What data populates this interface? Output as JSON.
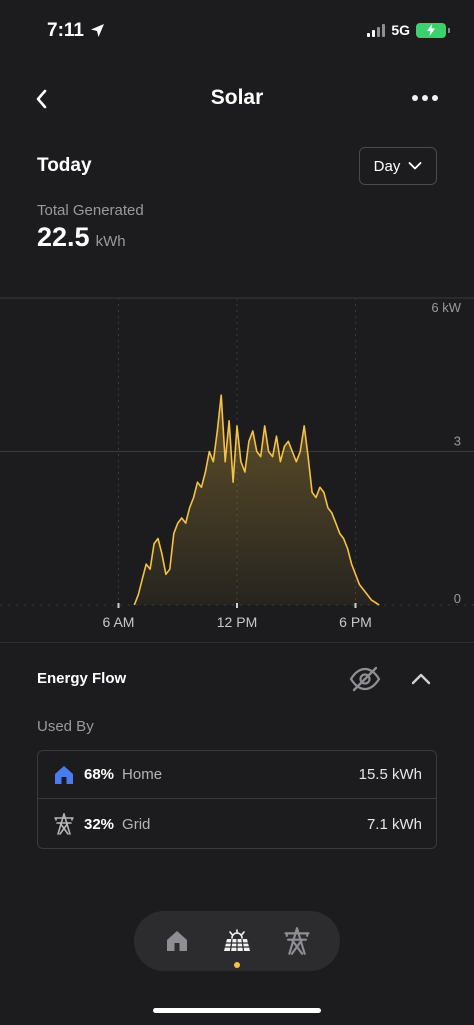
{
  "status_bar": {
    "time": "7:11",
    "network": "5G"
  },
  "header": {
    "title": "Solar"
  },
  "period": {
    "title": "Today",
    "selected": "Day"
  },
  "summary": {
    "label": "Total Generated",
    "value": "22.5",
    "unit": "kWh"
  },
  "chart_data": {
    "type": "area",
    "x_ticks": [
      "6 AM",
      "12 PM",
      "6 PM"
    ],
    "y_ticks": [
      "6 kW",
      "3",
      "0"
    ],
    "ylim": [
      0,
      6
    ],
    "xlim": [
      0,
      24
    ],
    "x": [
      6.8,
      7.0,
      7.2,
      7.4,
      7.6,
      7.8,
      8.0,
      8.2,
      8.4,
      8.6,
      8.8,
      9.0,
      9.2,
      9.4,
      9.6,
      9.8,
      10.0,
      10.2,
      10.4,
      10.6,
      10.8,
      11.0,
      11.2,
      11.4,
      11.6,
      11.8,
      12.0,
      12.2,
      12.4,
      12.6,
      12.8,
      13.0,
      13.2,
      13.4,
      13.6,
      13.8,
      14.0,
      14.2,
      14.4,
      14.6,
      14.8,
      15.0,
      15.2,
      15.4,
      15.6,
      15.8,
      16.0,
      16.2,
      16.4,
      16.6,
      16.8,
      17.0,
      17.2,
      17.4,
      17.6,
      17.8,
      18.0,
      18.2,
      18.4,
      18.6,
      18.8,
      19.0,
      19.2
    ],
    "values": [
      0.0,
      0.2,
      0.5,
      0.8,
      0.7,
      1.2,
      1.3,
      1.0,
      0.6,
      0.7,
      1.4,
      1.6,
      1.7,
      1.6,
      1.9,
      2.1,
      2.4,
      2.3,
      2.6,
      3.0,
      2.8,
      3.4,
      4.1,
      2.8,
      3.6,
      2.4,
      3.5,
      2.8,
      2.6,
      3.2,
      3.4,
      3.0,
      2.9,
      3.5,
      3.0,
      2.9,
      3.3,
      2.8,
      3.1,
      3.2,
      3.0,
      2.8,
      3.0,
      3.5,
      2.9,
      2.2,
      2.1,
      2.3,
      2.2,
      1.9,
      1.8,
      1.6,
      1.4,
      1.3,
      1.1,
      0.8,
      0.6,
      0.4,
      0.3,
      0.2,
      0.1,
      0.05,
      0.0
    ],
    "line_color": "#f5c242",
    "fill_color": "#f5c242",
    "grid": true
  },
  "energy_flow": {
    "title": "Energy Flow",
    "used_by_label": "Used By",
    "items": [
      {
        "pct": "68%",
        "name": "Home",
        "value": "15.5 kWh",
        "icon": "house-icon",
        "color": "#4a7cf0"
      },
      {
        "pct": "32%",
        "name": "Grid",
        "value": "7.1 kWh",
        "icon": "transmission-tower-icon",
        "color": "#b5b5b8"
      }
    ]
  },
  "nav": {
    "items": [
      {
        "icon": "house-icon",
        "active": false
      },
      {
        "icon": "solar-panel-icon",
        "active": true
      },
      {
        "icon": "transmission-tower-icon",
        "active": false
      }
    ],
    "accent": "#f5c242"
  }
}
